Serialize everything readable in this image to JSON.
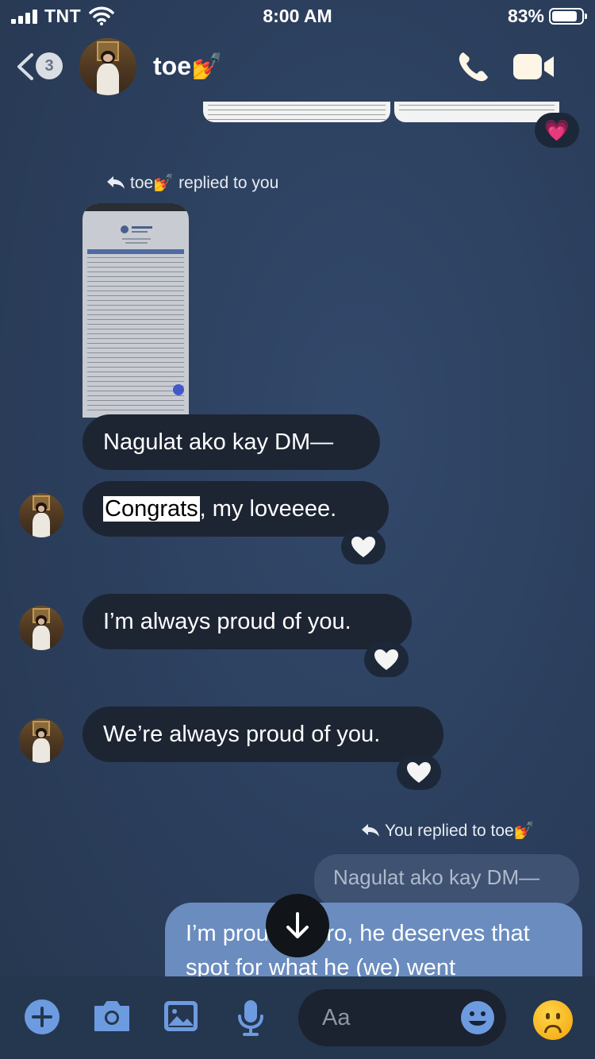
{
  "status_bar": {
    "carrier": "TNT",
    "time": "8:00 AM",
    "battery_percent": "83%",
    "battery_level": 0.83
  },
  "header": {
    "unread_count": "3",
    "contact_name": "toe💅"
  },
  "conversation": {
    "top_reaction": "💗",
    "reply_label_1": "toe💅 replied to you",
    "messages": [
      {
        "text": "Nagulat ako kay DM—"
      },
      {
        "highlight": "Congrats",
        "rest": ", my loveeee."
      },
      {
        "text": "I’m always proud of you."
      },
      {
        "text": "We’re always proud of you."
      }
    ],
    "reply_label_2": "You replied to toe💅",
    "quoted_message": "Nagulat ako kay DM—",
    "my_message": "I’m proud of bro, he deserves that spot for what he (we) went"
  },
  "composer": {
    "placeholder": "Aa"
  },
  "colors": {
    "background": "#2c3f5d",
    "incoming_bubble": "#1d2533",
    "outgoing_bubble": "#6a8cbf",
    "accent_blue": "#6d9be0"
  }
}
